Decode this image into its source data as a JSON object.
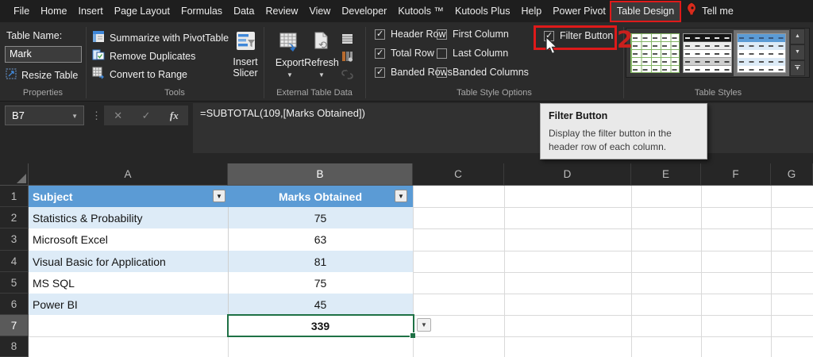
{
  "menu": {
    "items": [
      {
        "label": "File"
      },
      {
        "label": "Home"
      },
      {
        "label": "Insert"
      },
      {
        "label": "Page Layout"
      },
      {
        "label": "Formulas"
      },
      {
        "label": "Data"
      },
      {
        "label": "Review"
      },
      {
        "label": "View"
      },
      {
        "label": "Developer"
      },
      {
        "label": "Kutools ™"
      },
      {
        "label": "Kutools Plus"
      },
      {
        "label": "Help"
      },
      {
        "label": "Power Pivot"
      },
      {
        "label": "Table Design",
        "active": true
      }
    ],
    "tell_me_label": "Tell me"
  },
  "ribbon": {
    "properties": {
      "group_label": "Properties",
      "table_name_label": "Table Name:",
      "table_name_value": "Mark",
      "resize_table_label": "Resize Table"
    },
    "tools": {
      "group_label": "Tools",
      "buttons": [
        {
          "label": "Summarize with PivotTable",
          "icon": "pivottable-icon"
        },
        {
          "label": "Remove Duplicates",
          "icon": "remove-duplicates-icon"
        },
        {
          "label": "Convert to Range",
          "icon": "convert-to-range-icon"
        }
      ],
      "insert_slicer_line1": "Insert",
      "insert_slicer_line2": "Slicer"
    },
    "external": {
      "group_label": "External Table Data",
      "export_label": "Export",
      "refresh_label": "Refresh"
    },
    "style_options": {
      "group_label": "Table Style Options",
      "checkboxes": [
        {
          "label": "Header Row",
          "checked": true,
          "col": 0,
          "row": 0
        },
        {
          "label": "Total Row",
          "checked": true,
          "col": 0,
          "row": 1
        },
        {
          "label": "Banded Rows",
          "checked": true,
          "col": 0,
          "row": 2
        },
        {
          "label": "First Column",
          "checked": false,
          "col": 1,
          "row": 0
        },
        {
          "label": "Last Column",
          "checked": false,
          "col": 1,
          "row": 1
        },
        {
          "label": "Banded Columns",
          "checked": false,
          "col": 1,
          "row": 2
        }
      ],
      "filter_button": {
        "label": "Filter Button",
        "checked": true
      }
    },
    "table_styles": {
      "group_label": "Table Styles",
      "previews": [
        {
          "name": "table-style-light-green",
          "selected": false
        },
        {
          "name": "table-style-dark-header",
          "selected": false
        },
        {
          "name": "table-style-light-blue",
          "selected": true
        }
      ]
    }
  },
  "formula_bar": {
    "name_box": "B7",
    "fx_label": "fx",
    "formula": "=SUBTOTAL(109,[Marks Obtained])"
  },
  "tooltip": {
    "title": "Filter Button",
    "body": "Display the filter button in the header row of each column."
  },
  "annotations": {
    "callout_number": "2"
  },
  "sheet": {
    "column_headers": [
      "A",
      "B",
      "C",
      "D",
      "E",
      "F",
      "G"
    ],
    "row_headers": [
      "1",
      "2",
      "3",
      "4",
      "5",
      "6",
      "7",
      "8"
    ],
    "selected_cell": "B7",
    "selected_column": "B",
    "selected_row": "7",
    "table": {
      "header": {
        "subject": "Subject",
        "marks": "Marks Obtained"
      },
      "rows": [
        {
          "subject": "Statistics & Probability",
          "marks": "75"
        },
        {
          "subject": "Microsoft Excel",
          "marks": "63"
        },
        {
          "subject": "Visual Basic for Application",
          "marks": "81"
        },
        {
          "subject": "MS SQL",
          "marks": "75"
        },
        {
          "subject": "Power BI",
          "marks": "45"
        }
      ],
      "total": "339"
    }
  },
  "colors": {
    "header_blue": "#5B9BD5",
    "banded_row_blue": "#DDEBF7",
    "selection_green": "#1E7145",
    "annotation_red": "#DE1A1A"
  }
}
